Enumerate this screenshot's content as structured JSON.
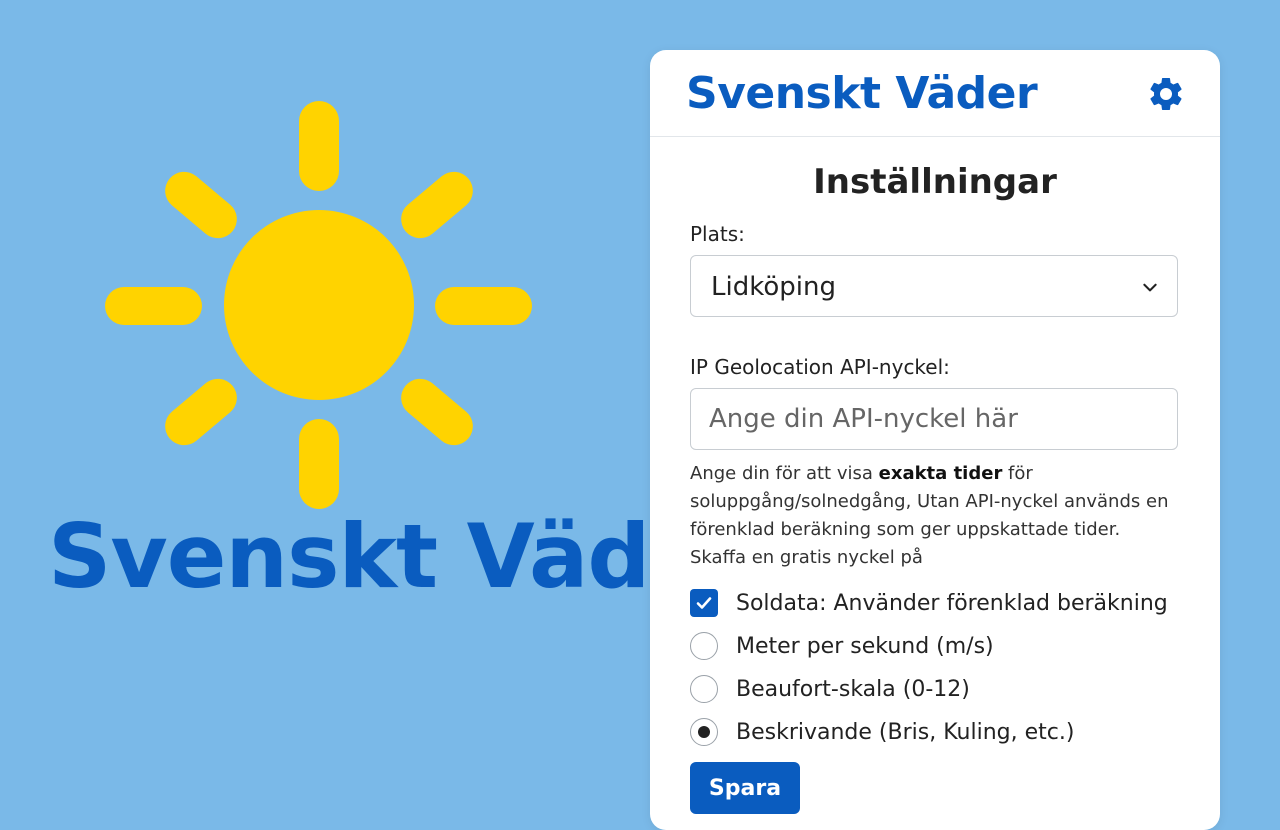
{
  "promo": {
    "title": "Svenskt Väder"
  },
  "app": {
    "title": "Svenskt Väder",
    "settings_icon": "gear-icon"
  },
  "settings": {
    "heading": "Inställningar",
    "location_label": "Plats:",
    "location_value": "Lidköping",
    "api_key_label": "IP Geolocation API-nyckel:",
    "api_key_value": "",
    "api_key_placeholder": "Ange din API-nyckel här",
    "help_text_1": "Ange din för att visa ",
    "help_text_bold": "exakta tider",
    "help_text_2": " för soluppgång/solnedgång, Utan API-nyckel används en förenklad beräkning som ger uppskattade tider. Skaffa en gratis nyckel på",
    "sun_data_label": "Soldata: Använder förenklad beräkning",
    "sun_data_checked": true,
    "wind_options": [
      {
        "label": "Meter per sekund (m/s)",
        "selected": false
      },
      {
        "label": "Beaufort-skala (0-12)",
        "selected": false
      },
      {
        "label": "Beskrivande (Bris, Kuling, etc.)",
        "selected": true
      }
    ],
    "save_label": "Spara"
  },
  "colors": {
    "background": "#7ab9e8",
    "brand_blue": "#0a5cbf",
    "sun_yellow": "#ffd300"
  }
}
